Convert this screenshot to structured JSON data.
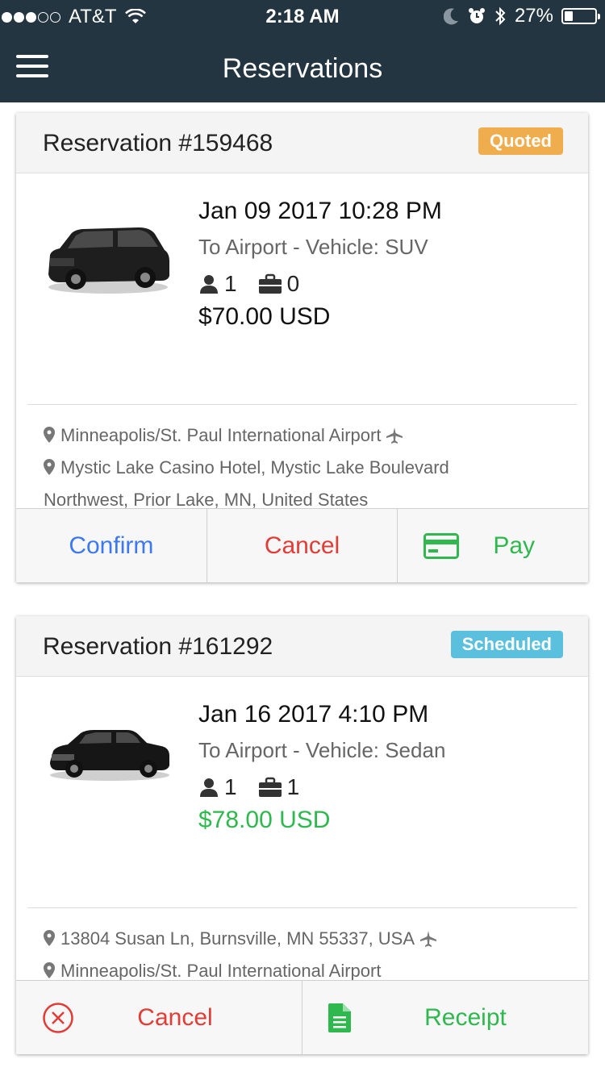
{
  "status_bar": {
    "carrier": "AT&T",
    "time": "2:18 AM",
    "battery": "27%",
    "battery_level": 0.27
  },
  "nav": {
    "title": "Reservations"
  },
  "reservations": [
    {
      "title": "Reservation #159468",
      "status": "Quoted",
      "datetime": "Jan 09 2017 10:28 PM",
      "trip": "To Airport - Vehicle: SUV",
      "passengers": "1",
      "luggage": "0",
      "price": "$70.00 USD",
      "price_color": "#111111",
      "vehicle_icon": "suv-image",
      "pickup": "Minneapolis/St. Paul International Airport",
      "dropoff": "Mystic Lake Casino Hotel, Mystic Lake Boulevard",
      "dropoff_line2": "Northwest, Prior Lake, MN, United States",
      "actions": {
        "confirm": "Confirm",
        "cancel": "Cancel",
        "pay": "Pay"
      }
    },
    {
      "title": "Reservation #161292",
      "status": "Scheduled",
      "datetime": "Jan 16 2017 4:10 PM",
      "trip": "To Airport - Vehicle: Sedan",
      "passengers": "1",
      "luggage": "1",
      "price": "$78.00 USD",
      "price_color": "#2eb84e",
      "vehicle_icon": "sedan-image",
      "pickup": "13804 Susan Ln, Burnsville, MN 55337, USA",
      "dropoff": "Minneapolis/St. Paul International Airport",
      "actions": {
        "cancel": "Cancel",
        "receipt": "Receipt"
      }
    }
  ],
  "colors": {
    "nav_bg": "#243542",
    "quoted": "#f0ad4e",
    "scheduled": "#5bc0de",
    "confirm": "#3c78f0",
    "cancel": "#e33b36",
    "success": "#2eb84e"
  }
}
